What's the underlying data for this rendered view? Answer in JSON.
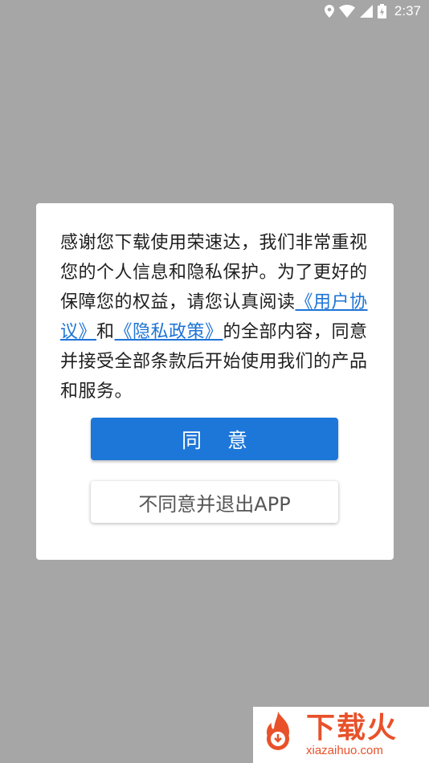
{
  "status_bar": {
    "time": "2:37",
    "icons": [
      "location-icon",
      "wifi-icon",
      "signal-icon",
      "battery-icon"
    ]
  },
  "dialog": {
    "message_part1": "感谢您下载使用荣速达，我们非常重视您的个人信息和隐私保护。为了更好的保障您的权益，请您认真阅读",
    "user_agreement_link": "《用户协议》",
    "and_text": "和",
    "privacy_policy_link": "《隐私政策》",
    "message_part2": "的全部内容，同意并接受全部条款后开始使用我们的产品和服务。",
    "agree_button": "同 意",
    "disagree_button": "不同意并退出APP"
  },
  "watermark": {
    "title": "下载火",
    "url": "xiazaihuo.com"
  },
  "colors": {
    "overlay": "#a6a6a6",
    "primary": "#1d77d9",
    "link": "#1e73d6",
    "watermark": "#e8512a"
  }
}
